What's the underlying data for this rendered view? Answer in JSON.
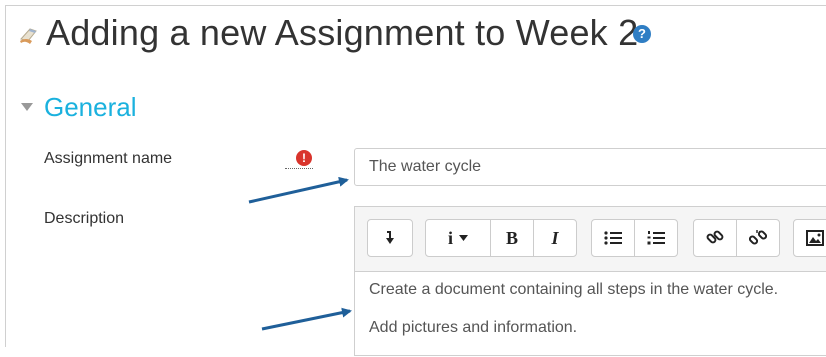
{
  "header": {
    "title": "Adding a new Assignment to Week 2",
    "help_icon": "question-circle-icon",
    "help_glyph": "?"
  },
  "section": {
    "title": "General",
    "expanded": true
  },
  "form": {
    "assignment_name": {
      "label": "Assignment name",
      "value": "The water cycle",
      "required_glyph": "!"
    },
    "description": {
      "label": "Description",
      "content": [
        "Create a document containing all steps in the water cycle.",
        "Add pictures and information."
      ]
    }
  },
  "toolbar": {
    "buttons": [
      "show-more-buttons-icon",
      "paragraph-styles-icon",
      "bold-icon",
      "italic-icon",
      "unordered-list-icon",
      "ordered-list-icon",
      "link-icon",
      "unlink-icon",
      "image-icon"
    ],
    "paragraph_glyph": "i",
    "bold_glyph": "B",
    "italic_glyph": "I"
  },
  "colors": {
    "section_title": "#1ab1de",
    "help_icon": "#2f7ec4",
    "required_icon": "#d9342c",
    "annotation_arrow": "#1f5f99"
  }
}
